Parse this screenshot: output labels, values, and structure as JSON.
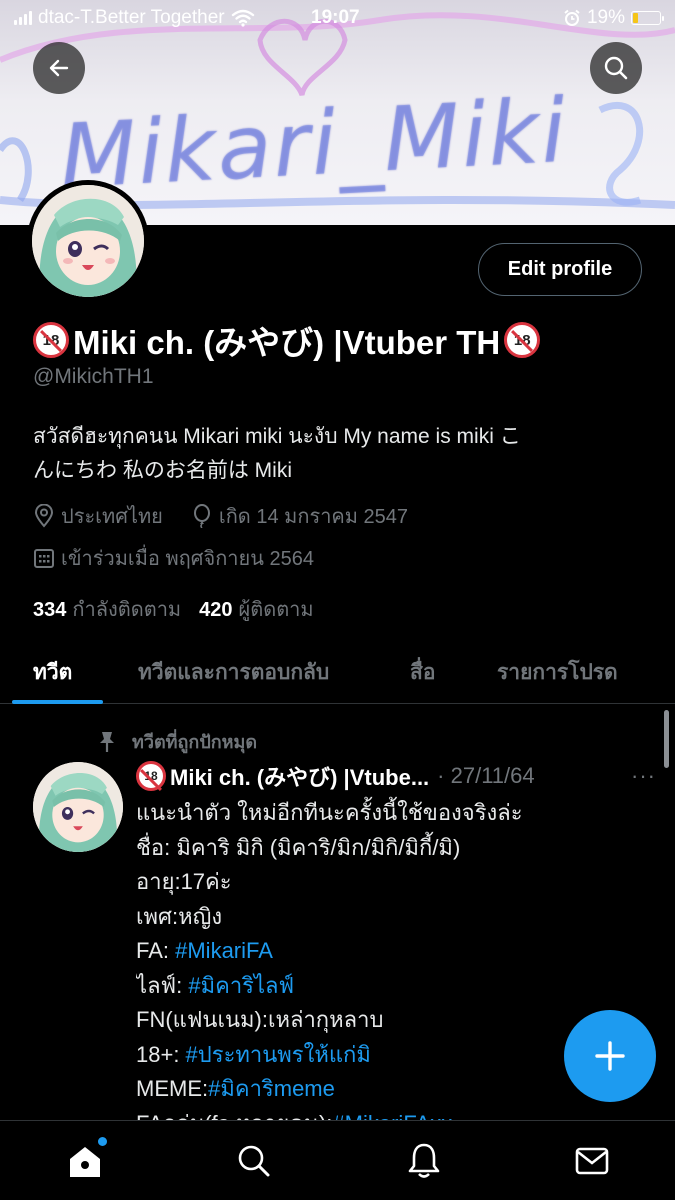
{
  "status_bar": {
    "carrier": "dtac-T.Better Together",
    "time": "19:07",
    "battery_percent": "19%",
    "battery_level": 0.19
  },
  "banner": {
    "text": "Mikari_Miki"
  },
  "profile": {
    "edit_label": "Edit profile",
    "display_name": "Miki ch. (みやび) |Vtuber TH",
    "badge_text": "18",
    "handle": "@MikichTH1",
    "bio_lines": [
      "สวัสดีฮะทุกคนน Mikari miki นะงับ My name is miki こ",
      "んにちわ 私のお名前は Miki"
    ],
    "location": "ประเทศไทย",
    "birthday": "เกิด 14 มกราคม 2547",
    "joined": "เข้าร่วมเมื่อ พฤศจิกายน 2564",
    "following_count": "334",
    "following_label": "กำลังติดตาม",
    "followers_count": "420",
    "followers_label": "ผู้ติดตาม"
  },
  "tabs": [
    {
      "label": "ทวีต",
      "active": true
    },
    {
      "label": "ทวีตและการตอบกลับ",
      "active": false
    },
    {
      "label": "สื่อ",
      "active": false
    },
    {
      "label": "รายการโปรด",
      "active": false
    }
  ],
  "pinned_tweet": {
    "pinned_label": "ทวีตที่ถูกปักหมุด",
    "author": "Miki ch. (みやび) |Vtube...",
    "date": "· 27/11/64",
    "more": "···",
    "lines": [
      {
        "text": "แนะนำตัว ใหม่อีกทีนะครั้งนี้ใช้ของจริงล่ะ",
        "tag": ""
      },
      {
        "text": "ชื่อ: มิคาริ มิกิ (มิคาริ/มิก/มิกิ/มิกี้/มิ)",
        "tag": ""
      },
      {
        "text": "อายุ:17ค่ะ",
        "tag": ""
      },
      {
        "text": "เพศ:หญิง",
        "tag": ""
      },
      {
        "text": "FA: ",
        "tag": "#MikariFA"
      },
      {
        "text": "ไลฟ์: ",
        "tag": "#มิคาริไลฟ์"
      },
      {
        "text": "FN(แฟนเนม):เหล่ากุหลาบ",
        "tag": ""
      },
      {
        "text": "18+: ",
        "tag": "#ประทานพรให้แก่มิ"
      },
      {
        "text": "MEME:",
        "tag": "#มิคาริmeme"
      },
      {
        "text": "FAกลุ่ม(fa หลายคน):",
        "tag": "#MikariFAxx"
      }
    ]
  },
  "colors": {
    "accent": "#1d9bf0",
    "background": "#000000",
    "muted": "#71767b",
    "badge_red": "#d9343f"
  },
  "icons": [
    "back-arrow-icon",
    "search-icon",
    "location-pin-icon",
    "balloon-icon",
    "calendar-icon",
    "pin-icon",
    "plus-icon",
    "home-icon",
    "bell-icon",
    "mail-icon"
  ]
}
